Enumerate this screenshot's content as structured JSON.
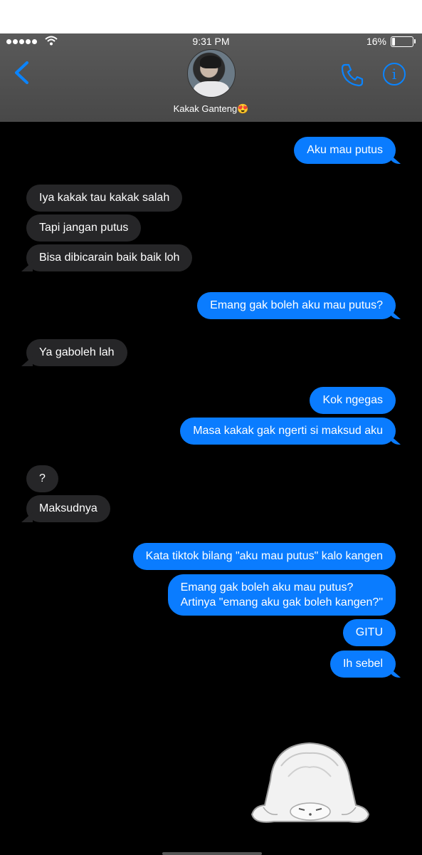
{
  "status_bar": {
    "time": "9:31 PM",
    "battery_percent": "16%",
    "battery_level": 0.16,
    "signal_bars": 5
  },
  "header": {
    "contact_name": "Kakak Ganteng😍"
  },
  "messages": [
    {
      "side": "out",
      "text": "Aku mau putus"
    },
    {
      "side": "in",
      "text": "Iya kakak tau kakak salah"
    },
    {
      "side": "in",
      "text": "Tapi jangan putus"
    },
    {
      "side": "in",
      "text": "Bisa dibicarain baik baik loh"
    },
    {
      "side": "out",
      "text": "Emang gak boleh aku mau putus?"
    },
    {
      "side": "in",
      "text": "Ya gaboleh lah"
    },
    {
      "side": "out",
      "text": "Kok ngegas"
    },
    {
      "side": "out",
      "text": "Masa kakak gak ngerti si maksud aku"
    },
    {
      "side": "in",
      "text": "?"
    },
    {
      "side": "in",
      "text": "Maksudnya"
    },
    {
      "side": "out",
      "text": "Kata tiktok bilang \"aku mau putus\" kalo kangen"
    },
    {
      "side": "out",
      "line1": "Emang gak boleh aku mau putus?",
      "line2": "Artinya \"emang aku gak boleh kangen?\""
    },
    {
      "side": "out",
      "text": "GITU"
    },
    {
      "side": "out",
      "text": "Ih sebel"
    }
  ],
  "colors": {
    "outgoing": "#0a7cff",
    "incoming": "#262628",
    "accent": "#0a84ff",
    "header": "#505050"
  },
  "icons": {
    "back": "chevron-left-icon",
    "call": "phone-icon",
    "info": "info-icon",
    "sticker": "sad-ghost-sticker"
  }
}
